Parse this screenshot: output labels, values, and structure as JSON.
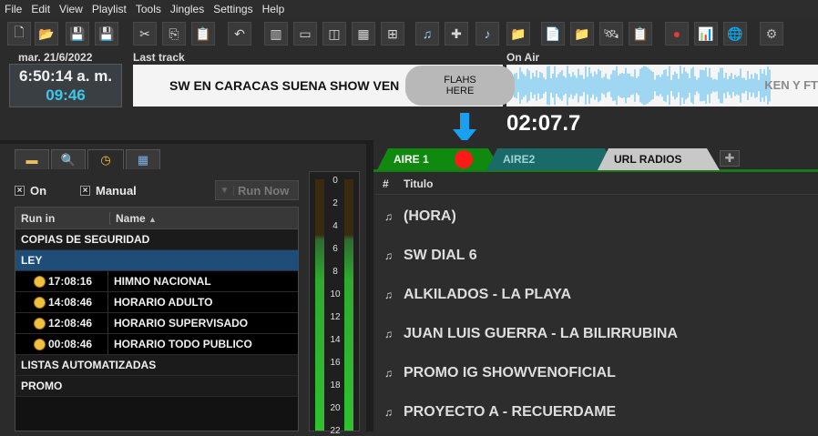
{
  "menu": [
    "File",
    "Edit",
    "View",
    "Playlist",
    "Tools",
    "Jingles",
    "Settings",
    "Help"
  ],
  "toolbar_icons": [
    {
      "name": "new-file-icon",
      "glyph": "🗋"
    },
    {
      "name": "open-folder-icon",
      "glyph": "📂"
    },
    {
      "name": "save-icon",
      "glyph": "💾"
    },
    {
      "name": "save-as-icon",
      "glyph": "💾"
    },
    {
      "name": "cut-icon",
      "glyph": "✂"
    },
    {
      "name": "copy-icon",
      "glyph": "⎘"
    },
    {
      "name": "paste-icon",
      "glyph": "📋"
    },
    {
      "name": "undo-icon",
      "glyph": "↶"
    },
    {
      "name": "layout-left-icon",
      "glyph": "▥"
    },
    {
      "name": "layout-single-icon",
      "glyph": "▭"
    },
    {
      "name": "layout-columns-icon",
      "glyph": "◫"
    },
    {
      "name": "layout-grid-icon",
      "glyph": "▦"
    },
    {
      "name": "layout-add-icon",
      "glyph": "⊞"
    },
    {
      "name": "add-track-icon",
      "glyph": "♫"
    },
    {
      "name": "add-item-icon",
      "glyph": "✚"
    },
    {
      "name": "add-audio-icon",
      "glyph": "♪"
    },
    {
      "name": "add-folder-icon",
      "glyph": "📁"
    },
    {
      "name": "report-icon",
      "glyph": "📄"
    },
    {
      "name": "folder-star-icon",
      "glyph": "📁"
    },
    {
      "name": "satellite-icon",
      "glyph": "🛰"
    },
    {
      "name": "clipboard-icon",
      "glyph": "📋"
    },
    {
      "name": "record-icon",
      "glyph": "●"
    },
    {
      "name": "stats-bars-icon",
      "glyph": "📊"
    },
    {
      "name": "globe-icon",
      "glyph": "🌐"
    },
    {
      "name": "gear-icon",
      "glyph": "⚙"
    }
  ],
  "clock": {
    "date": "mar. 21/6/2022",
    "time": "6:50:14 a. m.",
    "countdown": "09:46"
  },
  "last_track": {
    "label": "Last track",
    "text": "SW EN CARACAS SUENA SHOW VEN"
  },
  "flash": {
    "line1": "FLAHS",
    "line2": "HERE"
  },
  "on_air": {
    "label": "On Air",
    "text": "KEN Y FT",
    "timer": "02:07.7"
  },
  "left_tabs": [
    "folder-icon",
    "search-icon",
    "clock-icon",
    "calendar-icon"
  ],
  "options": {
    "on_label": "On",
    "manual_label": "Manual",
    "run_now_label": "Run Now"
  },
  "schedule": {
    "col_run_in": "Run in",
    "col_name": "Name",
    "rows": [
      {
        "type": "group",
        "name": "COPIAS DE SEGURIDAD"
      },
      {
        "type": "group-selected",
        "name": "LEY"
      },
      {
        "type": "item",
        "time": "17:08:16",
        "name": "HIMNO NACIONAL"
      },
      {
        "type": "item",
        "time": "14:08:46",
        "name": "HORARIO ADULTO"
      },
      {
        "type": "item",
        "time": "12:08:46",
        "name": "HORARIO SUPERVISADO"
      },
      {
        "type": "item",
        "time": "00:08:46",
        "name": "HORARIO TODO PUBLICO"
      },
      {
        "type": "group",
        "name": "LISTAS AUTOMATIZADAS"
      },
      {
        "type": "group",
        "name": "PROMO"
      }
    ]
  },
  "meter_scale": [
    "0",
    "2",
    "4",
    "6",
    "8",
    "10",
    "12",
    "14",
    "16",
    "18",
    "20",
    "22"
  ],
  "colors": {
    "aire1": "#0f8a0f",
    "aire2": "#1b6a6a",
    "url_radios": "#c8c8c8",
    "selected_row": "#1e4e78",
    "timer_accent": "#3ec8e8",
    "record_dot": "#ff1a1a",
    "arrow": "#1aa0f0"
  },
  "right_tabs": [
    {
      "label": "AIRE 1"
    },
    {
      "label": "AIRE2"
    },
    {
      "label": "URL RADIOS"
    }
  ],
  "playlist": {
    "col_num": "#",
    "col_title": "Titulo",
    "rows": [
      {
        "title": "(HORA)"
      },
      {
        "title": "SW DIAL 6"
      },
      {
        "title": "ALKILADOS - LA PLAYA"
      },
      {
        "title": "JUAN LUIS GUERRA - LA BILIRRUBINA"
      },
      {
        "title": "PROMO IG SHOWVENOFICIAL"
      },
      {
        "title": "PROYECTO A - RECUERDAME"
      }
    ]
  }
}
